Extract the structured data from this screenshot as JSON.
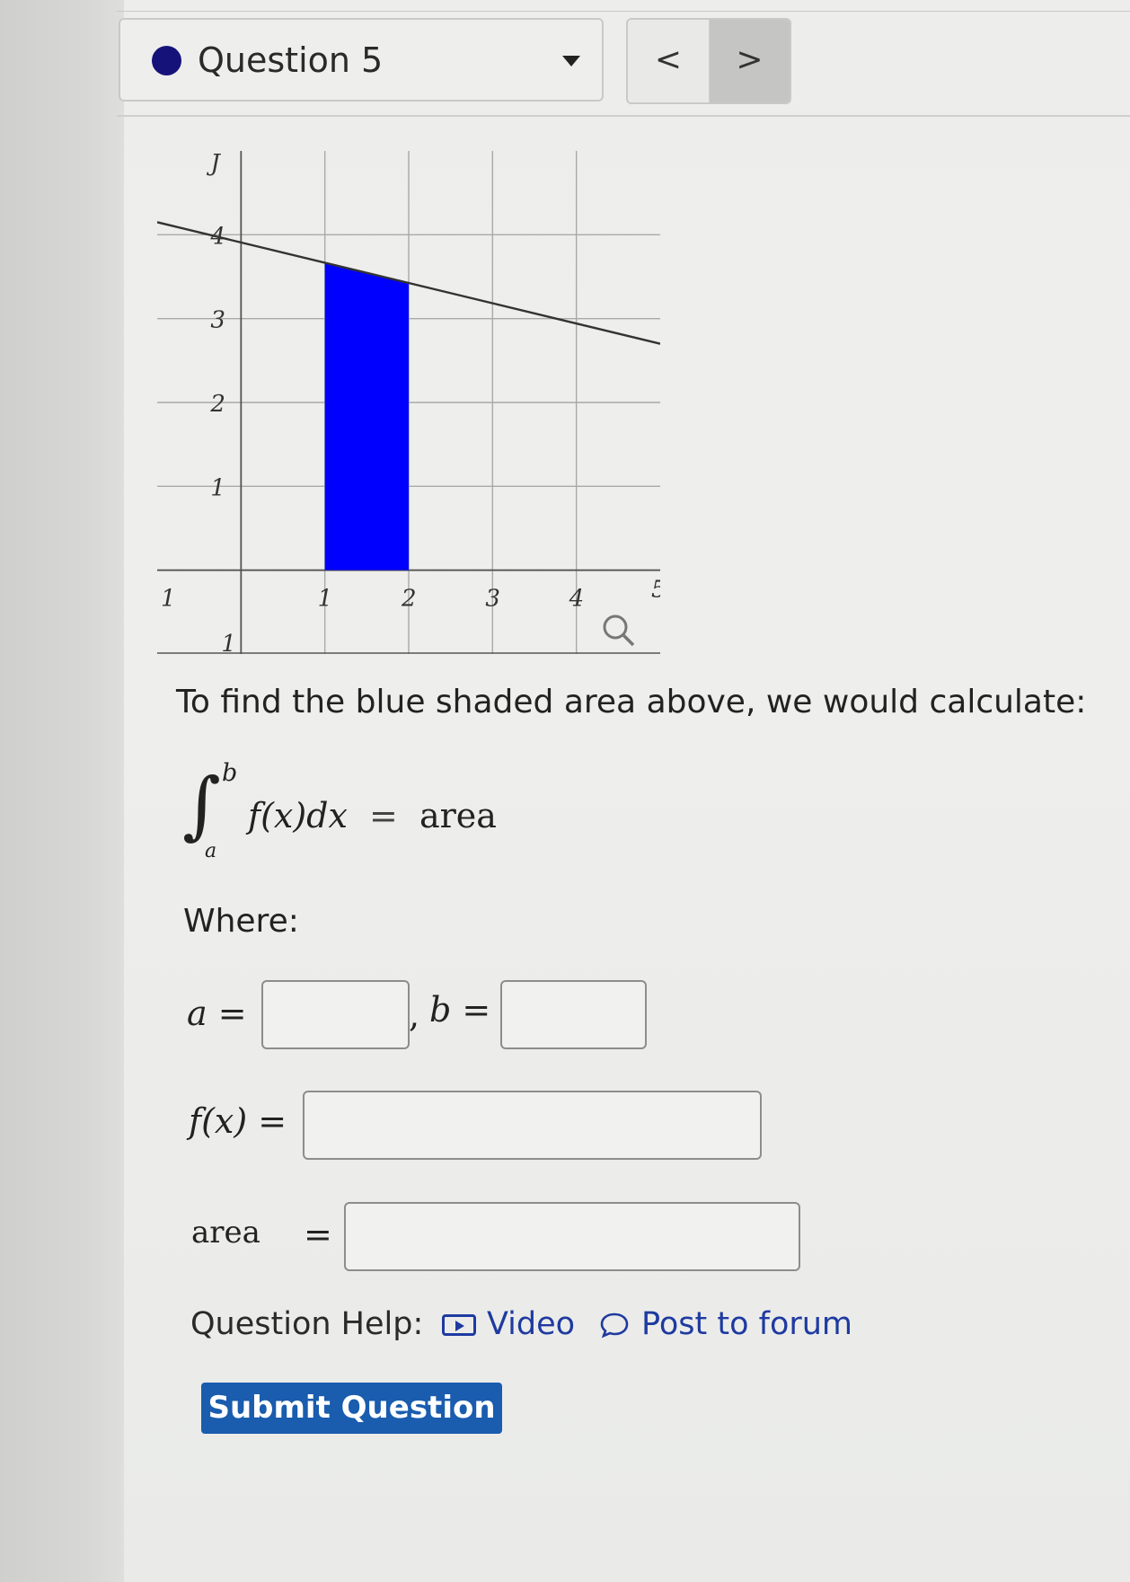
{
  "header": {
    "question_title": "Question 5",
    "prev_glyph": "<",
    "next_glyph": ">"
  },
  "chart_data": {
    "type": "line",
    "title": "",
    "xlabel": "",
    "ylabel": "",
    "x_ticks": [
      "1",
      "2",
      "3",
      "4"
    ],
    "y_ticks": [
      "1",
      "2",
      "3",
      "4"
    ],
    "extra_labels": {
      "top_left": "J",
      "bottom_left": "1",
      "bottom_small": "1",
      "right_fragment": "5"
    },
    "xlim": [
      -1,
      5
    ],
    "ylim": [
      -1,
      5
    ],
    "grid": true,
    "series": [
      {
        "x": [
          -1,
          5
        ],
        "y": [
          4.15,
          2.7
        ]
      }
    ],
    "shaded_region": {
      "x_from": 1,
      "x_to": 2,
      "color": "#0000ff"
    },
    "zoom_icon": "magnifier-icon"
  },
  "statement": "To find the blue shaded area above, we would calculate:",
  "integral": {
    "upper": "b",
    "lower": "a",
    "integrand": "f(x)dx",
    "equals": "=",
    "rhs": "area"
  },
  "where_label": "Where:",
  "inputs": {
    "a_label": "a =",
    "a_value": "",
    "comma": ",",
    "b_label": "b =",
    "b_value": "",
    "fx_label": "f(x) =",
    "fx_value": "",
    "area_label": "area",
    "area_eq": "=",
    "area_value": ""
  },
  "help": {
    "label": "Question Help:",
    "video": "Video",
    "forum": "Post to forum",
    "video_icon": "video-icon",
    "forum_icon": "chat-bubble-icon"
  },
  "submit_label": "Submit Question",
  "colors": {
    "dot": "#15137a",
    "link": "#1f3aa0",
    "button": "#1a5cae",
    "shade": "#0000ff"
  }
}
